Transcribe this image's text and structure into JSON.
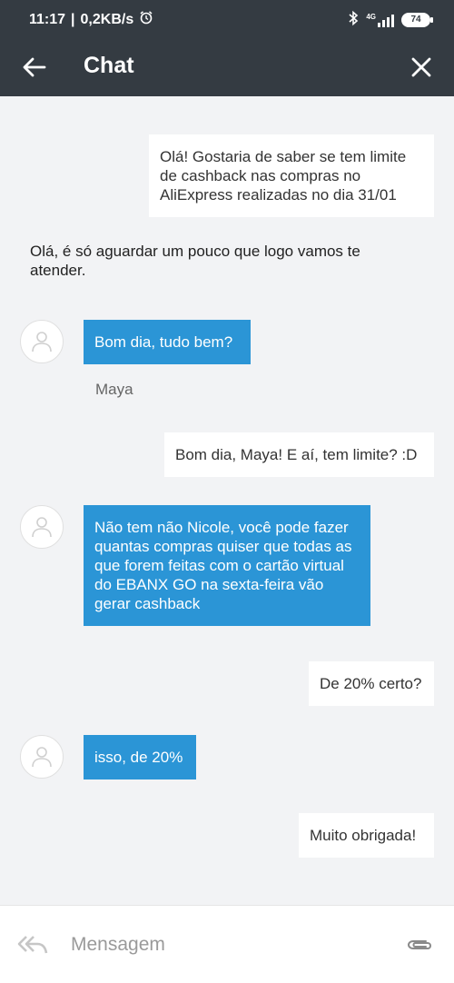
{
  "status": {
    "time": "11:17",
    "speed": "0,2KB/s",
    "network": "4G",
    "battery": "74"
  },
  "header": {
    "title": "Chat"
  },
  "messages": [
    {
      "type": "outgoing",
      "text": "Olá! Gostaria de saber se tem limite de cashback nas compras no AliExpress realizadas no dia 31/01"
    },
    {
      "type": "system",
      "text": "Olá, é só aguardar um pouco que logo vamos te atender."
    },
    {
      "type": "incoming",
      "text": "Bom dia, tudo bem?"
    },
    {
      "type": "sender",
      "text": "Maya"
    },
    {
      "type": "outgoing",
      "text": "Bom dia, Maya! E aí, tem limite? :D"
    },
    {
      "type": "incoming",
      "text": "Não tem não Nicole, você pode fazer quantas compras quiser que todas as que forem feitas com o cartão virtual do EBANX GO na sexta-feira vão gerar cashback"
    },
    {
      "type": "outgoing",
      "text": "De 20% certo?"
    },
    {
      "type": "incoming",
      "text": "isso, de 20%"
    },
    {
      "type": "outgoing",
      "text": "Muito obrigada!"
    }
  ],
  "composer": {
    "placeholder": "Mensagem"
  },
  "icons": {
    "back": "arrow-left-icon",
    "close": "close-icon",
    "avatar": "user-icon",
    "reply": "reply-all-icon",
    "attach": "paperclip-icon",
    "alarm": "alarm-icon",
    "bluetooth": "bluetooth-icon",
    "signal": "signal-icon"
  },
  "colors": {
    "header": "#343b42",
    "background": "#f2f3f5",
    "incoming_bubble": "#2b95d6",
    "outgoing_bubble": "#ffffff"
  }
}
